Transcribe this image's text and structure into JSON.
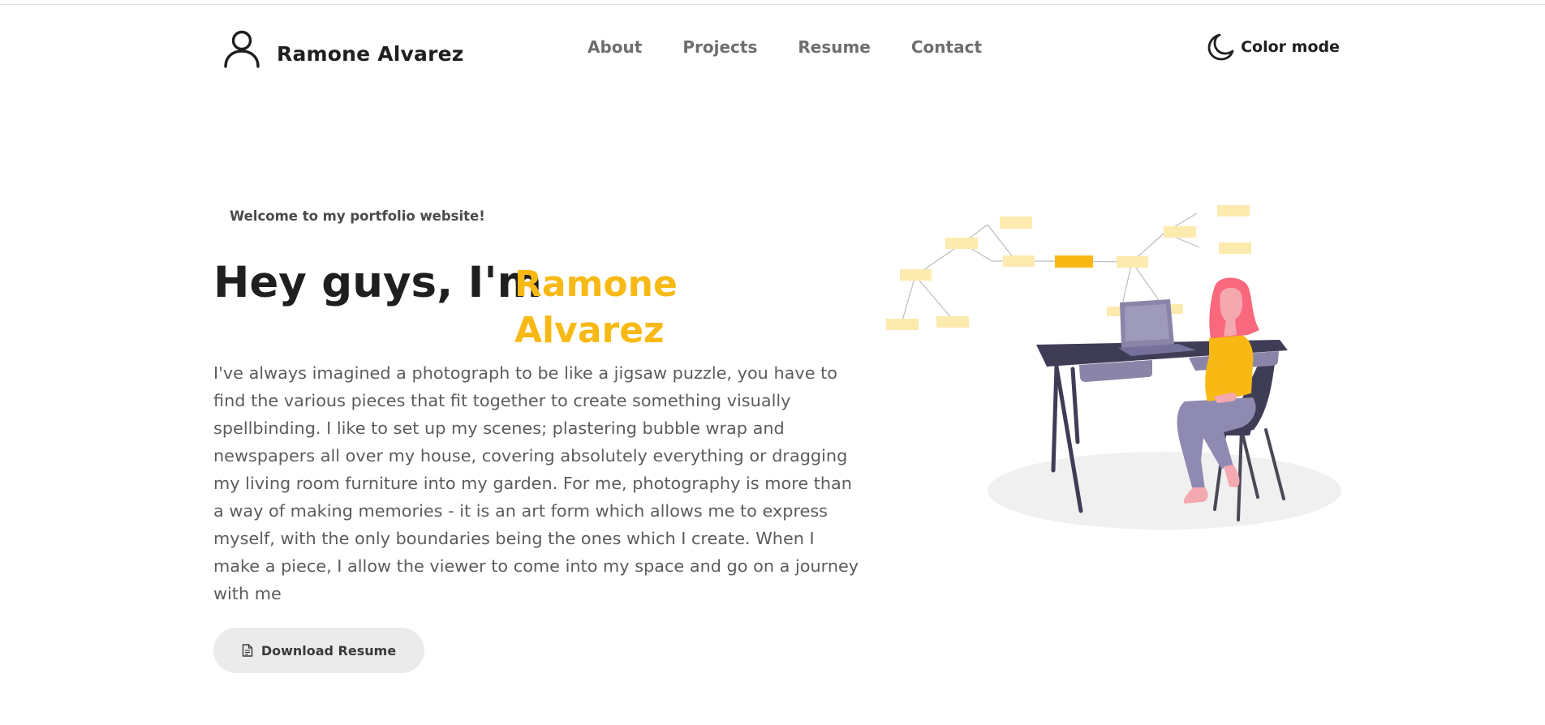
{
  "header": {
    "brand_name": "Ramone Alvarez",
    "nav": [
      "About",
      "Projects",
      "Resume",
      "Contact"
    ],
    "color_mode_label": "Color mode"
  },
  "hero": {
    "welcome": "Welcome to my portfolio website!",
    "greeting": "Hey guys, I'm",
    "name": "Ramone Alvarez",
    "bio": "I've always imagined a photograph to be like a jigsaw puzzle, you have to find the various pieces that fit together to create something visually spellbinding. I like to set up my scenes; plastering bubble wrap and newspapers all over my house, covering absolutely everything or dragging my living room furniture into my garden. For me, photography is more than a way of making memories - it is an art form which allows me to express myself, with the only boundaries being the ones which I create. When I make a piece, I allow the viewer to come into my space and go on a journey with me",
    "download_label": "Download Resume"
  },
  "icons": {
    "brand": "user-outline-icon",
    "color_mode": "crescent-moon-icon",
    "download": "document-icon"
  },
  "colors": {
    "accent": "#f8b915",
    "text": "#1f1f1f",
    "muted": "#6e6e6e",
    "button_bg": "#ebebeb"
  }
}
